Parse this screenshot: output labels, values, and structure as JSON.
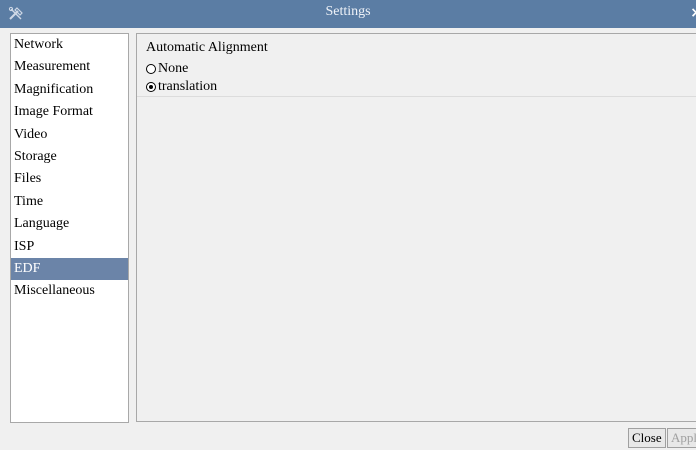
{
  "window": {
    "title": "Settings",
    "close_glyph": "×"
  },
  "sidebar": {
    "items": [
      {
        "label": "Network"
      },
      {
        "label": "Measurement"
      },
      {
        "label": "Magnification"
      },
      {
        "label": "Image Format"
      },
      {
        "label": "Video"
      },
      {
        "label": "Storage"
      },
      {
        "label": "Files"
      },
      {
        "label": "Time"
      },
      {
        "label": "Language"
      },
      {
        "label": "ISP"
      },
      {
        "label": "EDF",
        "selected": true
      },
      {
        "label": "Miscellaneous"
      }
    ]
  },
  "main": {
    "group_title": "Automatic Alignment",
    "options": [
      {
        "label": "None",
        "checked": false
      },
      {
        "label": "translation",
        "checked": true
      }
    ]
  },
  "footer": {
    "close_label": "Close",
    "apply_label": "Apply"
  },
  "colors": {
    "titlebar": "#5b7da4",
    "selected": "#6b84a8"
  },
  "icons": {
    "app": "tools-icon"
  }
}
